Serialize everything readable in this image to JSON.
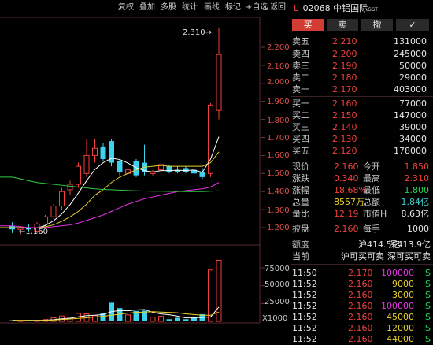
{
  "toolbar": {
    "items": [
      "复权",
      "叠加",
      "多股",
      "统计",
      "画线",
      "标记",
      "+自选",
      "返回"
    ]
  },
  "stock": {
    "marker": "L",
    "code_name": "02068 中铝国际",
    "tag": "GGT"
  },
  "tabs": [
    "买",
    "卖",
    "撤",
    "✓"
  ],
  "order_book": {
    "asks": [
      {
        "label": "卖五",
        "price": "2.210",
        "volume": "131000"
      },
      {
        "label": "卖四",
        "price": "2.200",
        "volume": "245000"
      },
      {
        "label": "卖三",
        "price": "2.190",
        "volume": "50000"
      },
      {
        "label": "卖二",
        "price": "2.180",
        "volume": "29000"
      },
      {
        "label": "卖一",
        "price": "2.170",
        "volume": "403000"
      }
    ],
    "bids": [
      {
        "label": "买一",
        "price": "2.160",
        "volume": "77000"
      },
      {
        "label": "买二",
        "price": "2.150",
        "volume": "147000"
      },
      {
        "label": "买三",
        "price": "2.140",
        "volume": "39000"
      },
      {
        "label": "买四",
        "price": "2.130",
        "volume": "34000"
      },
      {
        "label": "买五",
        "price": "2.120",
        "volume": "178000"
      }
    ]
  },
  "quote": {
    "rows": [
      [
        {
          "l": "现价",
          "v": "2.160",
          "c": "red"
        },
        {
          "l": "今开",
          "v": "1.850",
          "c": "red"
        }
      ],
      [
        {
          "l": "涨跌",
          "v": "0.340",
          "c": "red"
        },
        {
          "l": "最高",
          "v": "2.310",
          "c": "red"
        }
      ],
      [
        {
          "l": "涨幅",
          "v": "18.68%",
          "c": "red"
        },
        {
          "l": "最低",
          "v": "1.800",
          "c": "green"
        }
      ],
      [
        {
          "l": "总量",
          "v": "8557万",
          "c": "yellow"
        },
        {
          "l": "总额",
          "v": "1.84亿",
          "c": "cyan"
        }
      ],
      [
        {
          "l": "量比",
          "v": "12.19",
          "c": "red"
        },
        {
          "l": "市值H",
          "v": "8.63亿",
          "c": "white"
        }
      ]
    ],
    "lot": {
      "l1": "披盘",
      "v1": "2.160",
      "l2": "每手",
      "v2": "1000"
    },
    "quota": {
      "label": "额度",
      "sh": "沪414.5亿",
      "sz": "深413.9亿"
    },
    "current": {
      "label": "当前",
      "sh": "沪可买可卖",
      "sz": "深可买可卖"
    }
  },
  "trades": [
    {
      "time": "11:50",
      "price": "2.170",
      "vol": "100000",
      "flag": "S",
      "pc": "red",
      "vc": "magenta"
    },
    {
      "time": "11:52",
      "price": "2.160",
      "vol": "9000",
      "flag": "S",
      "pc": "red",
      "vc": "yellow"
    },
    {
      "time": "11:52",
      "price": "2.160",
      "vol": "3000",
      "flag": "S",
      "pc": "red",
      "vc": "yellow"
    },
    {
      "time": "11:52",
      "price": "2.160",
      "vol": "100000",
      "flag": "S",
      "pc": "red",
      "vc": "magenta"
    },
    {
      "time": "11:52",
      "price": "2.160",
      "vol": "45000",
      "flag": "S",
      "pc": "red",
      "vc": "yellow"
    },
    {
      "time": "11:52",
      "price": "2.160",
      "vol": "12000",
      "flag": "S",
      "pc": "red",
      "vc": "yellow"
    },
    {
      "time": "11:52",
      "price": "2.160",
      "vol": "44000",
      "flag": "S",
      "pc": "red",
      "vc": "yellow"
    }
  ],
  "price_axis": [
    "2.200",
    "2.100",
    "2.000",
    "1.900",
    "1.800",
    "1.700",
    "1.600",
    "1.500",
    "1.400",
    "1.300",
    "1.200"
  ],
  "volume_axis": [
    "75000",
    "50000",
    "25000"
  ],
  "volume_unit": "X1000",
  "annotations": {
    "high": "2.310",
    "low": "1.160"
  },
  "chart_data": {
    "type": "candlestick",
    "price_range": [
      1.15,
      2.33
    ],
    "volume_max": 86000,
    "candles": [
      {
        "o": 1.21,
        "h": 1.23,
        "l": 1.17,
        "c": 1.19,
        "v": 1500
      },
      {
        "o": 1.19,
        "h": 1.21,
        "l": 1.16,
        "c": 1.2,
        "v": 1000
      },
      {
        "o": 1.2,
        "h": 1.22,
        "l": 1.18,
        "c": 1.19,
        "v": 1800
      },
      {
        "o": 1.18,
        "h": 1.23,
        "l": 1.17,
        "c": 1.22,
        "v": 1200
      },
      {
        "o": 1.22,
        "h": 1.27,
        "l": 1.21,
        "c": 1.26,
        "v": 2500
      },
      {
        "o": 1.26,
        "h": 1.33,
        "l": 1.25,
        "c": 1.32,
        "v": 5000
      },
      {
        "o": 1.32,
        "h": 1.42,
        "l": 1.3,
        "c": 1.4,
        "v": 7500
      },
      {
        "o": 1.41,
        "h": 1.46,
        "l": 1.38,
        "c": 1.44,
        "v": 6000
      },
      {
        "o": 1.44,
        "h": 1.56,
        "l": 1.42,
        "c": 1.54,
        "v": 11000
      },
      {
        "o": 1.5,
        "h": 1.69,
        "l": 1.48,
        "c": 1.6,
        "v": 10500
      },
      {
        "o": 1.6,
        "h": 1.69,
        "l": 1.56,
        "c": 1.64,
        "v": 8000
      },
      {
        "o": 1.65,
        "h": 1.67,
        "l": 1.57,
        "c": 1.58,
        "v": 12000
      },
      {
        "o": 1.68,
        "h": 1.69,
        "l": 1.54,
        "c": 1.56,
        "v": 26000
      },
      {
        "o": 1.57,
        "h": 1.58,
        "l": 1.49,
        "c": 1.51,
        "v": 18500
      },
      {
        "o": 1.5,
        "h": 1.55,
        "l": 1.48,
        "c": 1.52,
        "v": 9000
      },
      {
        "o": 1.57,
        "h": 1.58,
        "l": 1.48,
        "c": 1.49,
        "v": 14500
      },
      {
        "o": 1.56,
        "h": 1.66,
        "l": 1.49,
        "c": 1.51,
        "v": 15000
      },
      {
        "o": 1.5,
        "h": 1.52,
        "l": 1.49,
        "c": 1.51,
        "v": 6000
      },
      {
        "o": 1.52,
        "h": 1.56,
        "l": 1.49,
        "c": 1.55,
        "v": 7000
      },
      {
        "o": 1.54,
        "h": 1.55,
        "l": 1.5,
        "c": 1.51,
        "v": 3000
      },
      {
        "o": 1.52,
        "h": 1.54,
        "l": 1.5,
        "c": 1.51,
        "v": 5000
      },
      {
        "o": 1.53,
        "h": 1.54,
        "l": 1.5,
        "c": 1.51,
        "v": 3000
      },
      {
        "o": 1.52,
        "h": 1.54,
        "l": 1.48,
        "c": 1.5,
        "v": 6500
      },
      {
        "o": 1.51,
        "h": 1.53,
        "l": 1.47,
        "c": 1.48,
        "v": 10000
      },
      {
        "o": 1.5,
        "h": 1.89,
        "l": 1.48,
        "c": 1.88,
        "v": 72000
      },
      {
        "o": 1.85,
        "h": 2.31,
        "l": 1.8,
        "c": 2.16,
        "v": 85500
      }
    ],
    "ma_series": [
      {
        "name": "MA5",
        "color": "#ffffff",
        "values": [
          1.2,
          1.2,
          1.2,
          1.198,
          1.212,
          1.238,
          1.276,
          1.328,
          1.392,
          1.46,
          1.522,
          1.56,
          1.584,
          1.578,
          1.558,
          1.532,
          1.516,
          1.508,
          1.516,
          1.516,
          1.518,
          1.516,
          1.52,
          1.506,
          1.58,
          1.704
        ]
      },
      {
        "name": "MA10",
        "color": "#e8d22e",
        "values": [
          1.2,
          1.2,
          1.2,
          1.2,
          1.205,
          1.215,
          1.235,
          1.26,
          1.29,
          1.33,
          1.38,
          1.41,
          1.45,
          1.48,
          1.5,
          1.52,
          1.535,
          1.54,
          1.545,
          1.54,
          1.54,
          1.54,
          1.54,
          1.54,
          1.56,
          1.62
        ]
      },
      {
        "name": "MA20",
        "color": "#e634e6",
        "values": [
          1.21,
          1.205,
          1.2,
          1.2,
          1.2,
          1.205,
          1.21,
          1.215,
          1.225,
          1.24,
          1.255,
          1.27,
          1.29,
          1.31,
          1.33,
          1.345,
          1.36,
          1.37,
          1.38,
          1.39,
          1.4,
          1.405,
          1.41,
          1.415,
          1.425,
          1.45
        ]
      },
      {
        "name": "MA60",
        "color": "#2ecc40",
        "values": [
          1.48,
          1.47,
          1.46,
          1.45,
          1.445,
          1.44,
          1.435,
          1.43,
          1.425,
          1.42,
          1.415,
          1.412,
          1.41,
          1.408,
          1.406,
          1.404,
          1.403,
          1.402,
          1.402,
          1.401,
          1.401,
          1.4,
          1.4,
          1.4,
          1.402,
          1.404
        ]
      }
    ],
    "volume_ma": [
      {
        "name": "VMA5",
        "color": "#ffffff",
        "values": [
          1500,
          1300,
          1400,
          1400,
          1600,
          2300,
          3600,
          4400,
          6400,
          8000,
          8600,
          9500,
          13500,
          15100,
          14700,
          16000,
          16600,
          12600,
          10300,
          9200,
          7300,
          4800,
          4900,
          5500,
          6100,
          20000
        ]
      },
      {
        "name": "VMA10",
        "color": "#e8d22e",
        "values": [
          1500,
          1400,
          1400,
          1400,
          1500,
          1800,
          2600,
          3300,
          4100,
          5000,
          6000,
          7000,
          8500,
          10000,
          11500,
          12500,
          13000,
          13500,
          13000,
          12500,
          12000,
          10500,
          9500,
          8500,
          8500,
          13000
        ]
      }
    ]
  }
}
